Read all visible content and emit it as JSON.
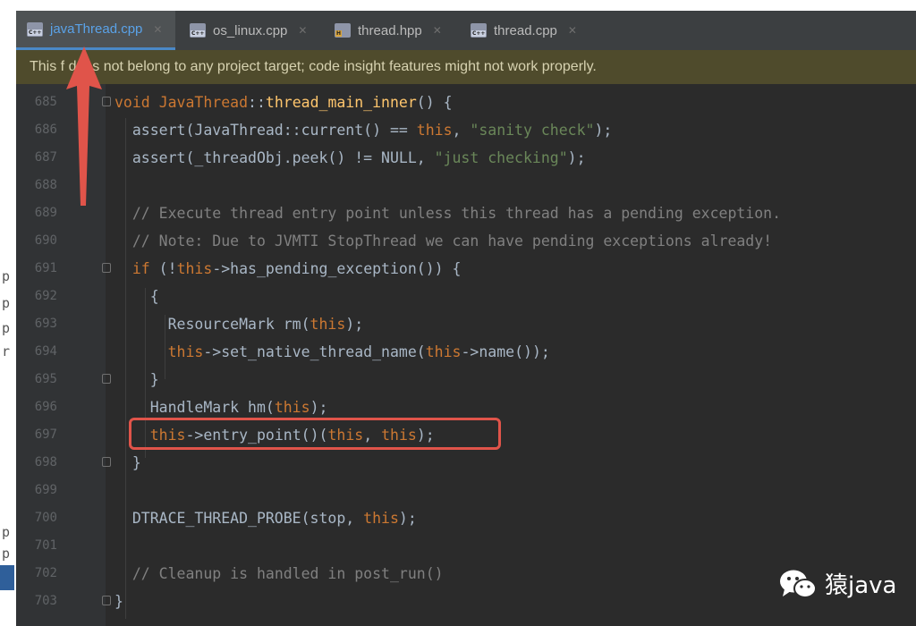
{
  "tabs": [
    {
      "label": "javaThread.cpp",
      "icon": "cpp-file-icon",
      "active": true
    },
    {
      "label": "os_linux.cpp",
      "icon": "cpp-file-icon",
      "active": false
    },
    {
      "label": "thread.hpp",
      "icon": "hpp-file-icon",
      "active": false
    },
    {
      "label": "thread.cpp",
      "icon": "cpp-file-icon",
      "active": false
    }
  ],
  "banner": {
    "text": "This f   does not belong to any project target; code insight features might not work properly."
  },
  "editor": {
    "line_numbers": [
      "685",
      "686",
      "687",
      "688",
      "689",
      "690",
      "691",
      "692",
      "693",
      "694",
      "695",
      "696",
      "697",
      "698",
      "699",
      "700",
      "701",
      "702",
      "703"
    ]
  },
  "watermark": {
    "text": "猿java",
    "icon": "wechat-icon"
  },
  "left_edge": {
    "glyphs": [
      "p",
      "p",
      "p",
      "r",
      "p",
      "p"
    ]
  },
  "colors": {
    "editor_bg": "#2b2b2b",
    "keyword": "#cc7832",
    "function": "#ffc66d",
    "string": "#6a8759",
    "comment": "#808080",
    "annotation_red": "#e0544a",
    "active_tab": "#5aa2e8"
  }
}
